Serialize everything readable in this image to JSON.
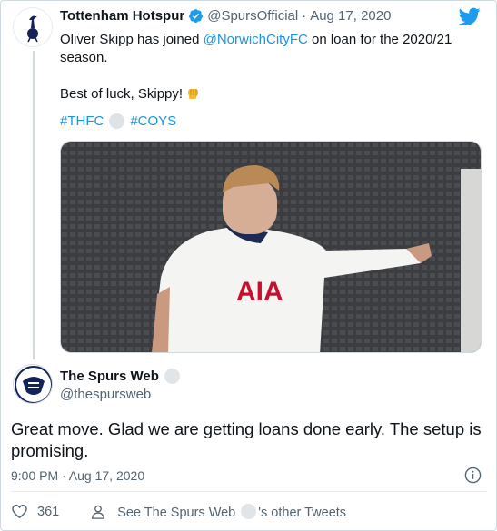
{
  "original_tweet": {
    "name": "Tottenham Hotspur",
    "handle": "@SpursOfficial",
    "separator": "·",
    "date": "Aug 17, 2020",
    "text_prefix": "Oliver Skipp has joined ",
    "mention": "@NorwichCityFC",
    "text_suffix": " on loan for the 2020/21 season.",
    "line2": "Best of luck, Skippy! ",
    "hashtag1": "#THFC",
    "hashtag2": "#COYS",
    "photo_text": "AIA"
  },
  "reply": {
    "name": "The Spurs Web",
    "handle": "@thespursweb",
    "text": "Great move. Glad we are getting loans done early. The setup is promising.",
    "timestamp": "9:00 PM · Aug 17, 2020"
  },
  "actions": {
    "likes": "361",
    "see_prefix": "See The Spurs Web",
    "see_suffix": "'s other Tweets"
  },
  "icons": [
    "spurs-logo-icon",
    "verified-icon",
    "twitter-bird-icon",
    "fist-emoji-icon",
    "info-icon",
    "heart-icon",
    "person-icon"
  ],
  "colors": {
    "link": "#1b95e0",
    "verified": "#1d9bf0",
    "muted": "#536471",
    "bird": "#1d9bf0"
  }
}
